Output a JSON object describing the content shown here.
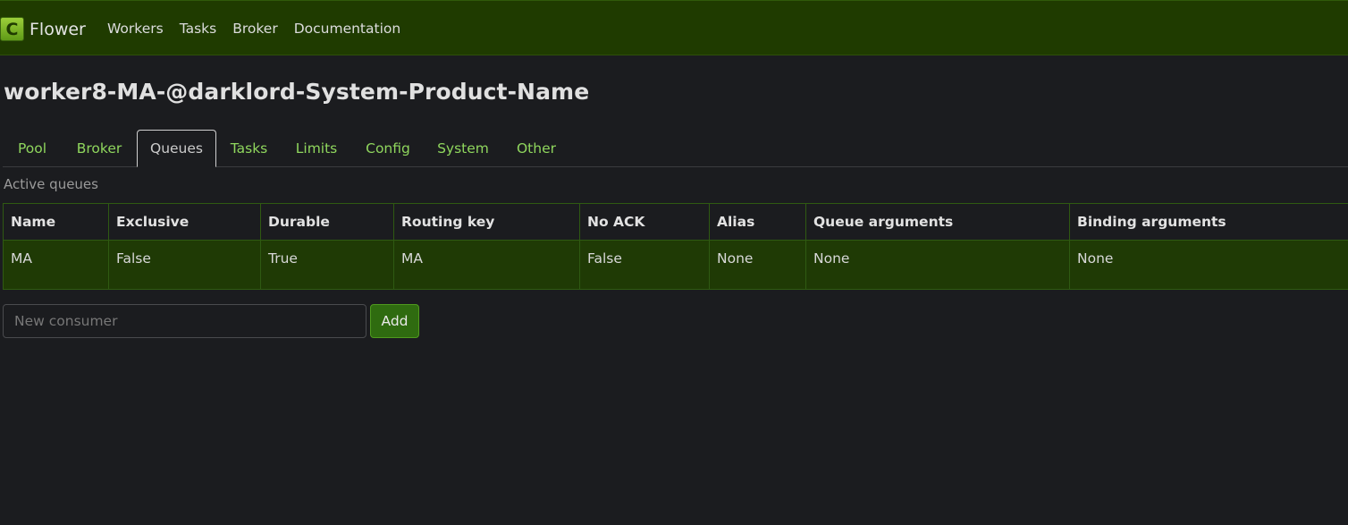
{
  "navbar": {
    "logo_letter": "C",
    "brand": "Flower",
    "links": [
      "Workers",
      "Tasks",
      "Broker",
      "Documentation"
    ]
  },
  "page": {
    "title": "worker8-MA-@darklord-System-Product-Name"
  },
  "tabs": [
    {
      "label": "Pool",
      "active": false
    },
    {
      "label": "Broker",
      "active": false
    },
    {
      "label": "Queues",
      "active": true
    },
    {
      "label": "Tasks",
      "active": false
    },
    {
      "label": "Limits",
      "active": false
    },
    {
      "label": "Config",
      "active": false
    },
    {
      "label": "System",
      "active": false
    },
    {
      "label": "Other",
      "active": false
    }
  ],
  "queues": {
    "section_label": "Active queues",
    "columns": [
      "Name",
      "Exclusive",
      "Durable",
      "Routing key",
      "No ACK",
      "Alias",
      "Queue arguments",
      "Binding arguments"
    ],
    "rows": [
      [
        "MA",
        "False",
        "True",
        "MA",
        "False",
        "None",
        "None",
        "None"
      ]
    ]
  },
  "consumer_form": {
    "placeholder": "New consumer",
    "value": "",
    "add_label": "Add"
  },
  "colors": {
    "navbar_bg": "#1f3b00",
    "tab_link": "#8fd65d",
    "row_highlight": "#1f3a05",
    "button_bg": "#2f6b10"
  }
}
